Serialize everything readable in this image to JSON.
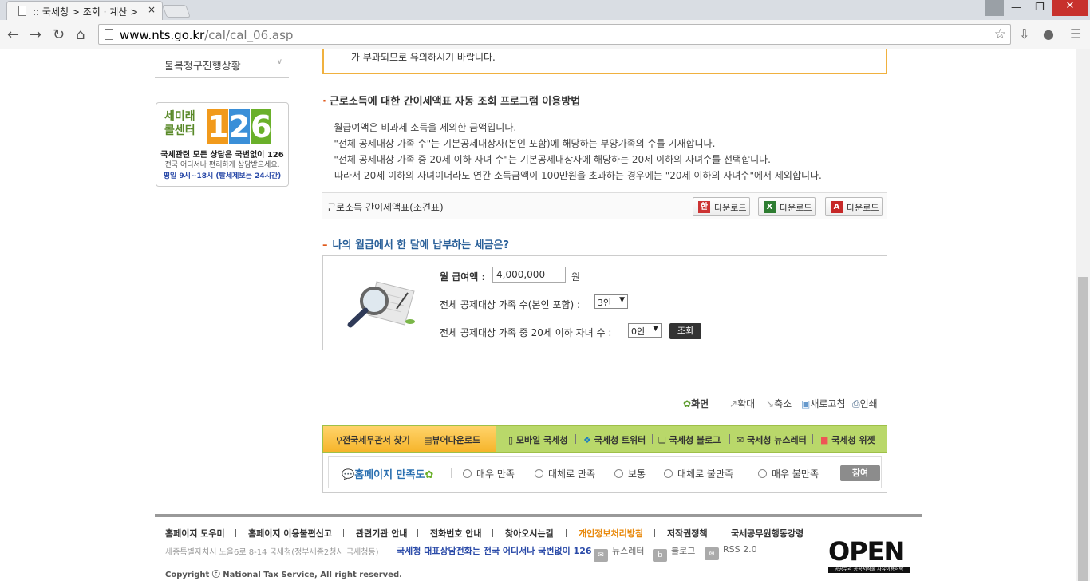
{
  "browser": {
    "tab_title": ":: 국세청 > 조회 · 계산 >",
    "tab_close": "×",
    "url_host": "www.nts.go.kr",
    "url_path": "/cal/cal_06.asp"
  },
  "sidebar": {
    "menu_item": "불복청구진행상황",
    "banner": {
      "brand": "세미래\n콜센터",
      "number": [
        "1",
        "2",
        "6"
      ],
      "line1": "국세관련 모든 상담은 국번없이 126",
      "line2": "전국 어디서나 편리하게 상담받으세요.",
      "line3": "평일 9시~18시 (탈세제보는 24시간)"
    }
  },
  "notice": {
    "text": "가 부과되므로 유의하시기 바랍니다."
  },
  "guide": {
    "title": "근로소득에 대한 간이세액표 자동 조회 프로그램 이용방법",
    "items": [
      "월급여액은 비과세 소득을 제외한 금액입니다.",
      "\"전체 공제대상 가족 수\"는 기본공제대상자(본인 포함)에 해당하는 부양가족의 수를 기재합니다.",
      "\"전체 공제대상 가족 중 20세 이하 자녀 수\"는 기본공제대상자에 해당하는 20세 이하의 자녀수를 선택합니다.",
      "따라서 20세 이하의 자녀이더라도 연간 소득금액이 100만원을 초과하는 경우에는 \"20세 이하의 자녀수\"에서 제외합니다."
    ]
  },
  "downloads": {
    "label": "근로소득 간이세액표(조견표)",
    "buttons": [
      "다운로드",
      "다운로드",
      "다운로드"
    ]
  },
  "calculator": {
    "heading": "나의 월급에서 한 달에 납부하는 세금은?",
    "salary_label": "월 급여액 :",
    "salary_value": "4,000,000",
    "salary_unit": "원",
    "family_label": "전체 공제대상 가족 수(본인 포함) :",
    "family_value": "3인",
    "children_label": "전체 공제대상 가족 중 20세 이하 자녀 수 :",
    "children_value": "0인",
    "submit": "조회"
  },
  "utilities": {
    "screen": "화면",
    "zoom_in": "확대",
    "zoom_out": "축소",
    "refresh": "새로고침",
    "print": "인쇄"
  },
  "link_bar": [
    "전국세무관서 찾기",
    "뷰어다운로드",
    "모바일 국세청",
    "국세청 트위터",
    "국세청 블로그",
    "국세청 뉴스레터",
    "국세청 위젯"
  ],
  "survey": {
    "title": "홈페이지 만족도",
    "options": [
      "매우 만족",
      "대체로 만족",
      "보통",
      "대체로 불만족",
      "매우 불만족"
    ],
    "submit": "참여"
  },
  "footer": {
    "links": [
      "홈페이지 도우미",
      "홈페이지 이용불편신고",
      "관련기관 안내",
      "전화번호 안내",
      "찾아오시는길",
      "개인정보처리방침",
      "저작권정책",
      "국세공무원행동강령"
    ],
    "address": "세종특별자치시 노을6로 8-14 국세청(정부세종2청사 국세청동)",
    "hotline": "국세청 대표상담전화는 전국 어디서나 국번없이 126",
    "newsletter": "뉴스레터",
    "blog": "블로그",
    "rss": "RSS 2.0",
    "copyright": "Copyright ⓒ National Tax Service, All right reserved.",
    "open_logo": "OPEN",
    "open_sub": "공공누리  공공저작물 자유이용허락"
  },
  "colors": {
    "accent_orange": "#f0b13f",
    "link_blue": "#2a6099",
    "privacy_orange": "#e8890c",
    "banner_orange": "#f19a1c",
    "banner_blue": "#3a8fd8",
    "banner_green": "#6ab02a"
  }
}
